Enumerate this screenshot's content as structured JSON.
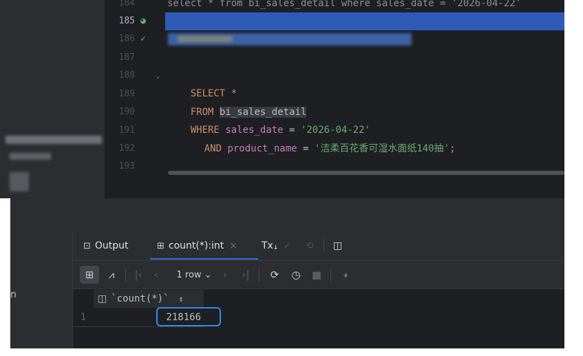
{
  "editor": {
    "line_numbers": [
      "184",
      "185",
      "186",
      "187",
      "188",
      "189",
      "190",
      "191",
      "192",
      "193"
    ],
    "line184_text": "select * from bi_sales_detail where sales_date = '2026-04-22'",
    "query": {
      "l188_kw": "SELECT",
      "l188_rest": " *",
      "l189_kw": "FROM",
      "l189_table": "bi_sales_detail",
      "l190_kw": "WHERE",
      "l190_col": "sales_date",
      "l190_op": " = ",
      "l190_val": "'2026-04-22'",
      "l191_kw": "AND",
      "l191_col": "product_name",
      "l191_op": " = ",
      "l191_val": "'洁柔百花香可湿水面纸140抽'",
      "l191_end": ";"
    }
  },
  "tabs": {
    "output_label": "Output",
    "result_label": "count(*):int",
    "close_glyph": "×",
    "tx_label": "Tx",
    "tx_sub": "↓"
  },
  "toolbar": {
    "rows_label": "1 row",
    "rows_chevron": "⌄"
  },
  "grid": {
    "column_header": "`count(*)`",
    "sort_glyph": "⇕",
    "row_number": "1",
    "value": "218166"
  },
  "stray_text": "n",
  "colors": {
    "accent": "#3574f0",
    "highlight_box": "#2f8cf5",
    "keyword": "#cf8e6d",
    "string": "#6aab73",
    "column": "#c77dbb"
  }
}
